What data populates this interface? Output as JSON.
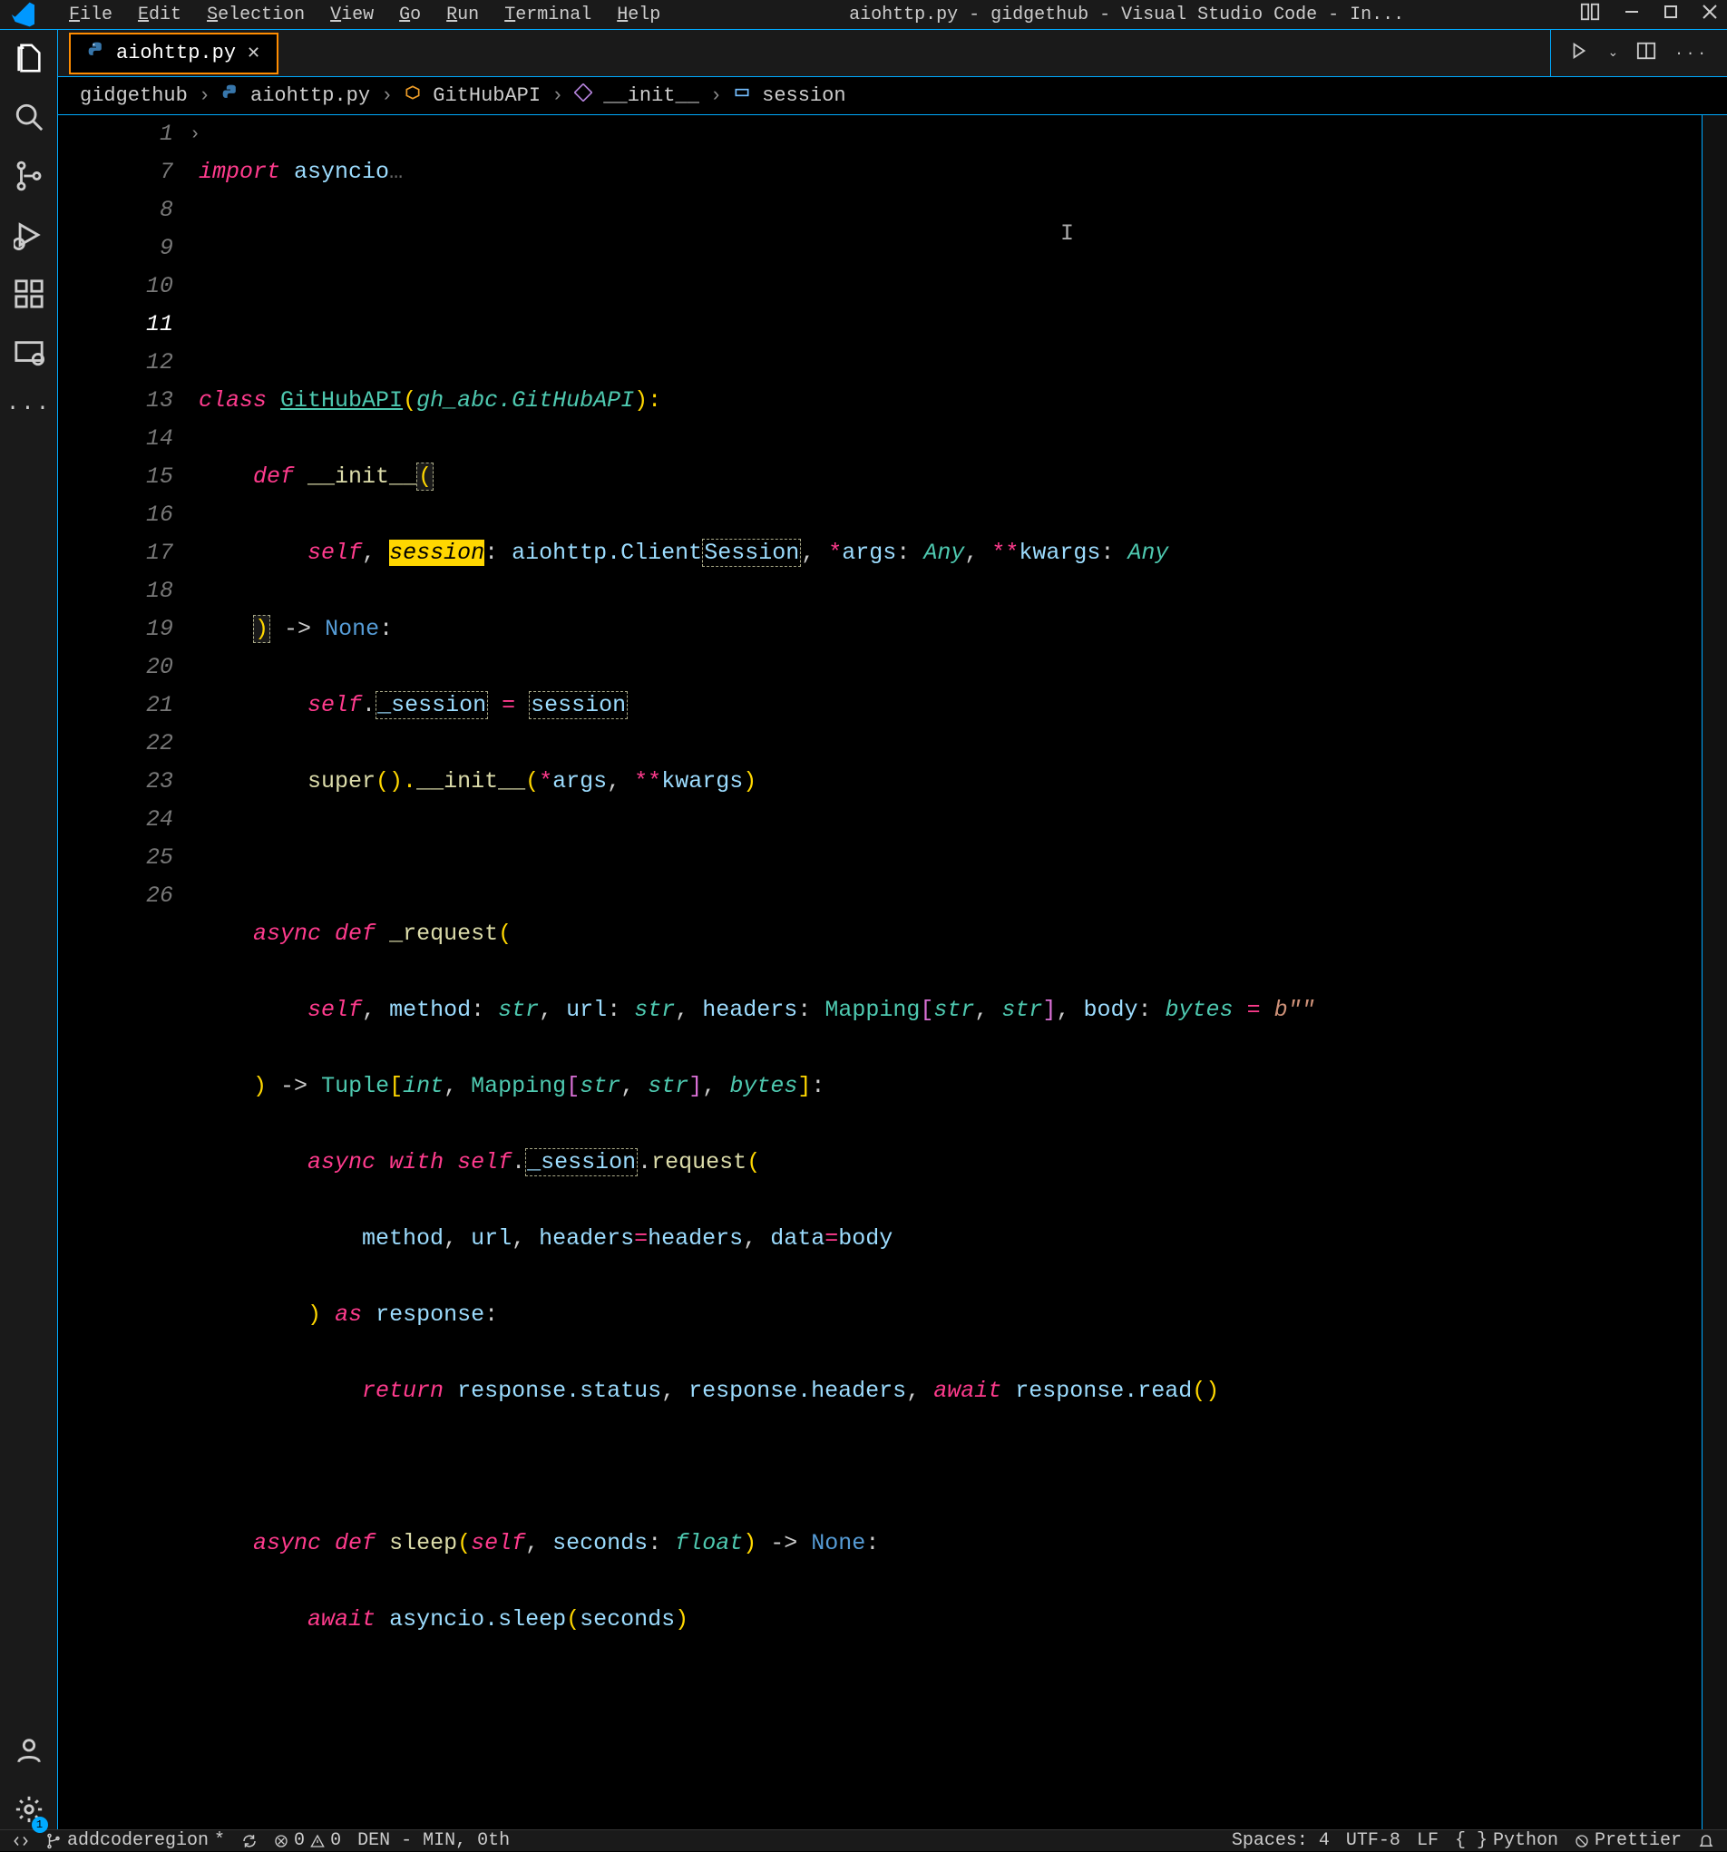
{
  "titlebar": {
    "menus": [
      "File",
      "Edit",
      "Selection",
      "View",
      "Go",
      "Run",
      "Terminal",
      "Help"
    ],
    "title": "aiohttp.py - gidgethub - Visual Studio Code - In..."
  },
  "tab": {
    "filename": "aiohttp.py"
  },
  "breadcrumb": {
    "items": [
      "gidgethub",
      "aiohttp.py",
      "GitHubAPI",
      "__init__",
      "session"
    ]
  },
  "gutter": {
    "lines": [
      "1",
      "7",
      "8",
      "9",
      "10",
      "11",
      "12",
      "13",
      "14",
      "15",
      "16",
      "17",
      "18",
      "19",
      "20",
      "21",
      "22",
      "23",
      "24",
      "25",
      "26"
    ],
    "active": "11"
  },
  "code": {
    "l1_import": "import",
    "l1_mod": "asyncio",
    "l1_dots": "…",
    "l9_class": "class",
    "l9_name": "GitHubAPI",
    "l9_paren1": "(",
    "l9_base": "gh_abc.GitHubAPI",
    "l9_paren2": "):",
    "l10_def": "def",
    "l10_name": "__init__",
    "l10_paren": "(",
    "l11_self": "self",
    "l11_c1": ",",
    "l11_session": "session",
    "l11_colon": ":",
    "l11_type": "aiohttp.Client",
    "l11_type2": "Session",
    "l11_c2": ",",
    "l11_star": "*",
    "l11_args": "args",
    "l11_c3": ":",
    "l11_any1": "Any",
    "l11_c4": ",",
    "l11_dstar": "**",
    "l11_kwargs": "kwargs",
    "l11_c5": ":",
    "l11_any2": "Any",
    "l12_paren": ")",
    "l12_arrow": "->",
    "l12_none": "None",
    "l12_colon": ":",
    "l13_self": "self",
    "l13_dot": ".",
    "l13_sess": "_session",
    "l13_eq": "=",
    "l13_sess2": "session",
    "l14_super": "super",
    "l14_p": "().",
    "l14_init": "__init__",
    "l14_p2": "(",
    "l14_star": "*",
    "l14_args": "args",
    "l14_c": ",",
    "l14_dstar": "**",
    "l14_kwargs": "kwargs",
    "l14_p3": ")",
    "l16_async": "async",
    "l16_def": "def",
    "l16_name": "_request",
    "l16_p": "(",
    "l17_self": "self",
    "l17_c1": ",",
    "l17_method": "method",
    "l17_c2": ":",
    "l17_str1": "str",
    "l17_c3": ",",
    "l17_url": "url",
    "l17_c4": ":",
    "l17_str2": "str",
    "l17_c5": ",",
    "l17_headers": "headers",
    "l17_c6": ":",
    "l17_mapping": "Mapping",
    "l17_b1": "[",
    "l17_str3": "str",
    "l17_c7": ",",
    "l17_str4": "str",
    "l17_b2": "]",
    "l17_c8": ",",
    "l17_body": "body",
    "l17_c9": ":",
    "l17_bytes": "bytes",
    "l17_eq": "=",
    "l17_bstr": "b\"\"",
    "l18_p1": ")",
    "l18_arrow": "->",
    "l18_tuple": "Tuple",
    "l18_b1": "[",
    "l18_int": "int",
    "l18_c1": ",",
    "l18_mapping": "Mapping",
    "l18_b2": "[",
    "l18_str1": "str",
    "l18_c2": ",",
    "l18_str2": "str",
    "l18_b3": "]",
    "l18_c3": ",",
    "l18_bytes": "bytes",
    "l18_b4": "]",
    "l18_colon": ":",
    "l19_async": "async",
    "l19_with": "with",
    "l19_self": "self",
    "l19_dot": ".",
    "l19_sess": "_session",
    "l19_dot2": ".",
    "l19_req": "request",
    "l19_p": "(",
    "l20_method": "method",
    "l20_c1": ",",
    "l20_url": "url",
    "l20_c2": ",",
    "l20_headers": "headers",
    "l20_eq1": "=",
    "l20_headers2": "headers",
    "l20_c3": ",",
    "l20_data": "data",
    "l20_eq2": "=",
    "l20_body": "body",
    "l21_p": ")",
    "l21_as": "as",
    "l21_resp": "response",
    "l21_colon": ":",
    "l22_return": "return",
    "l22_resp1": "response.status",
    "l22_c1": ",",
    "l22_resp2": "response.headers",
    "l22_c2": ",",
    "l22_await": "await",
    "l22_resp3": "response.read",
    "l22_p": "()",
    "l24_async": "async",
    "l24_def": "def",
    "l24_name": "sleep",
    "l24_p1": "(",
    "l24_self": "self",
    "l24_c1": ",",
    "l24_seconds": "seconds",
    "l24_c2": ":",
    "l24_float": "float",
    "l24_p2": ")",
    "l24_arrow": "->",
    "l24_none": "None",
    "l24_colon": ":",
    "l25_await": "await",
    "l25_call": "asyncio.sleep",
    "l25_p1": "(",
    "l25_arg": "seconds",
    "l25_p2": ")"
  },
  "statusbar": {
    "remote": "",
    "branch": "addcoderegion",
    "sync": "",
    "errors": "0",
    "warnings": "0",
    "mode": "DEN - MIN, 0th",
    "spaces": "Spaces: 4",
    "encoding": "UTF-8",
    "eol": "LF",
    "lang": "Python",
    "prettier": "Prettier",
    "bell": ""
  }
}
